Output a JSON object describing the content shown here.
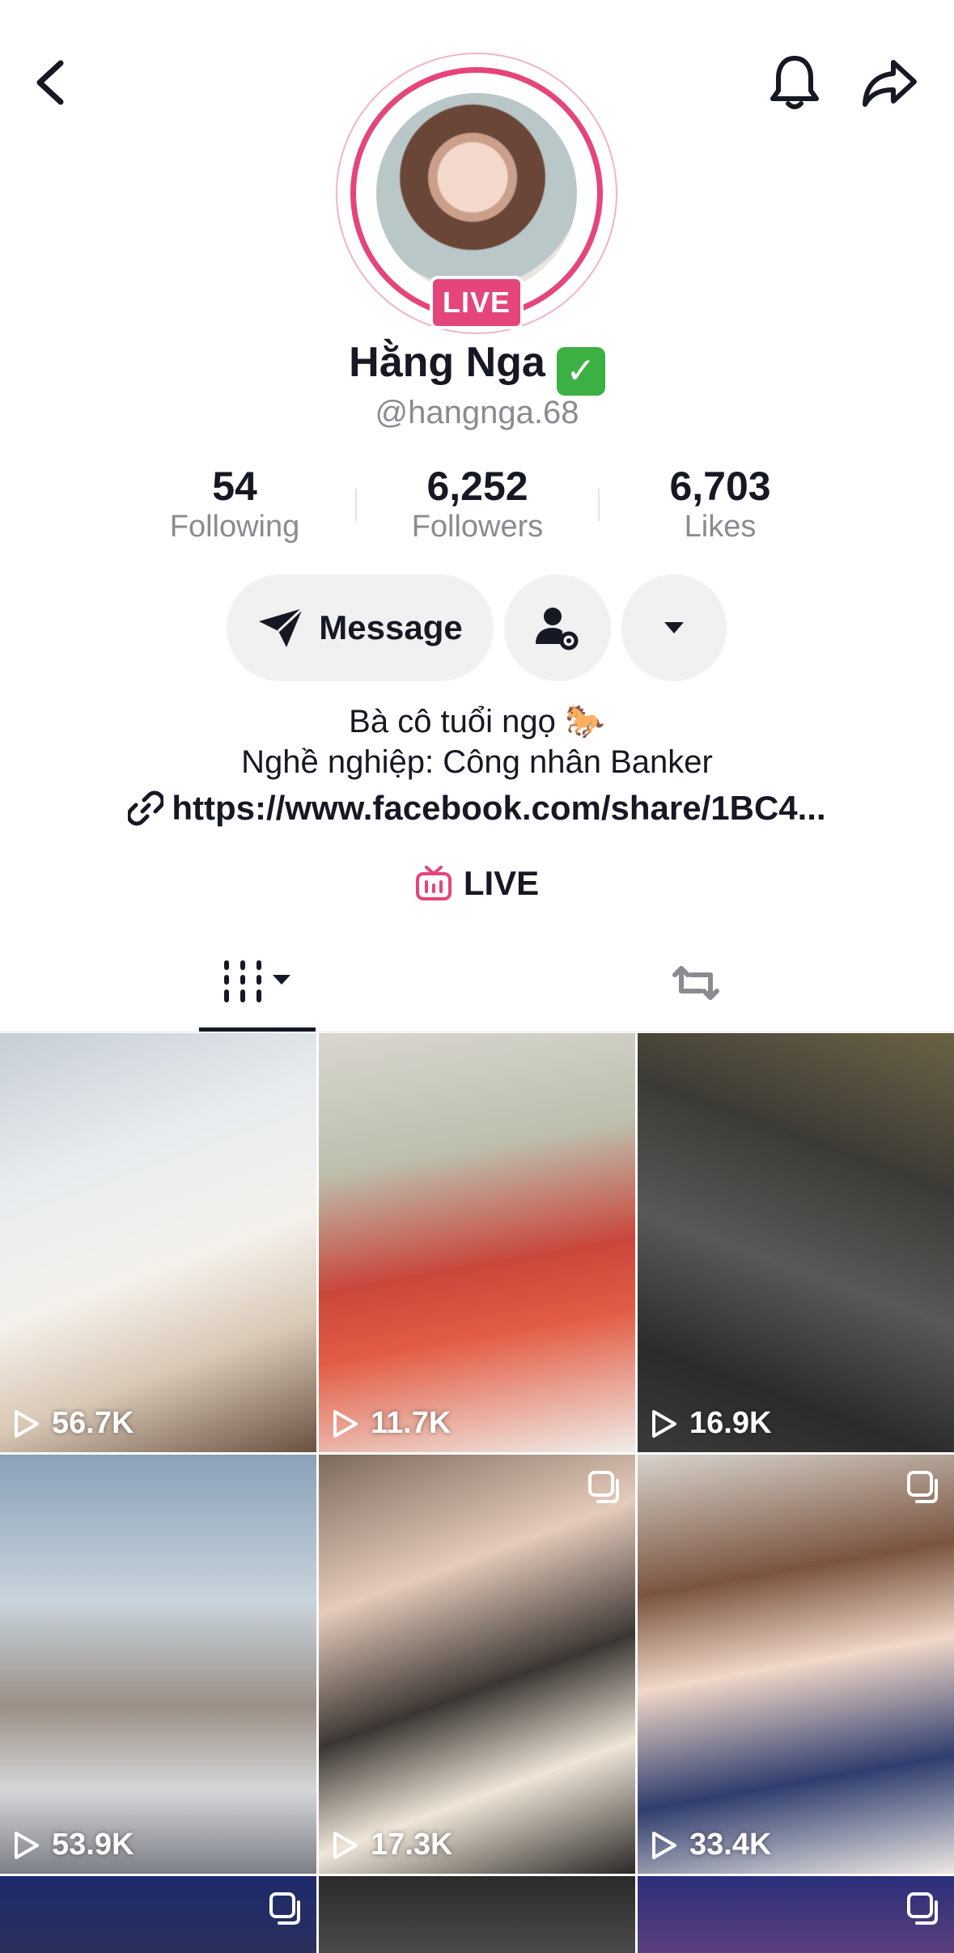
{
  "profile": {
    "name": "Hằng Nga",
    "verified_emoji": "✓",
    "handle": "@hangnga.68",
    "live_badge": "LIVE"
  },
  "stats": [
    {
      "value": "54",
      "label": "Following"
    },
    {
      "value": "6,252",
      "label": "Followers"
    },
    {
      "value": "6,703",
      "label": "Likes"
    }
  ],
  "actions": {
    "message_label": "Message"
  },
  "bio": {
    "line1": "Bà cô tuổi ngọ 🐎",
    "line2": "Nghề nghiệp: Công nhân Banker",
    "link": "https://www.facebook.com/share/1BC4..."
  },
  "live_link": "LIVE",
  "icons": {
    "back": "chevron-left-icon",
    "notify": "bell-icon",
    "share": "share-arrow-icon",
    "send": "paper-plane-icon",
    "user_settings": "user-gear-icon",
    "dropdown": "caret-down-icon",
    "link": "link-icon",
    "live_tv": "live-tv-icon",
    "videos_tab": "grid-bars-icon",
    "repost_tab": "repost-icon",
    "play": "play-icon"
  },
  "colors": {
    "accent": "#e4467b",
    "text": "#161823",
    "muted": "#8a8b91",
    "button_bg": "#f1f1f2"
  },
  "videos": [
    {
      "views": "56.7K"
    },
    {
      "views": "11.7K"
    },
    {
      "views": "16.9K"
    },
    {
      "views": "53.9K"
    },
    {
      "views": "17.3K"
    },
    {
      "views": "33.4K"
    }
  ]
}
